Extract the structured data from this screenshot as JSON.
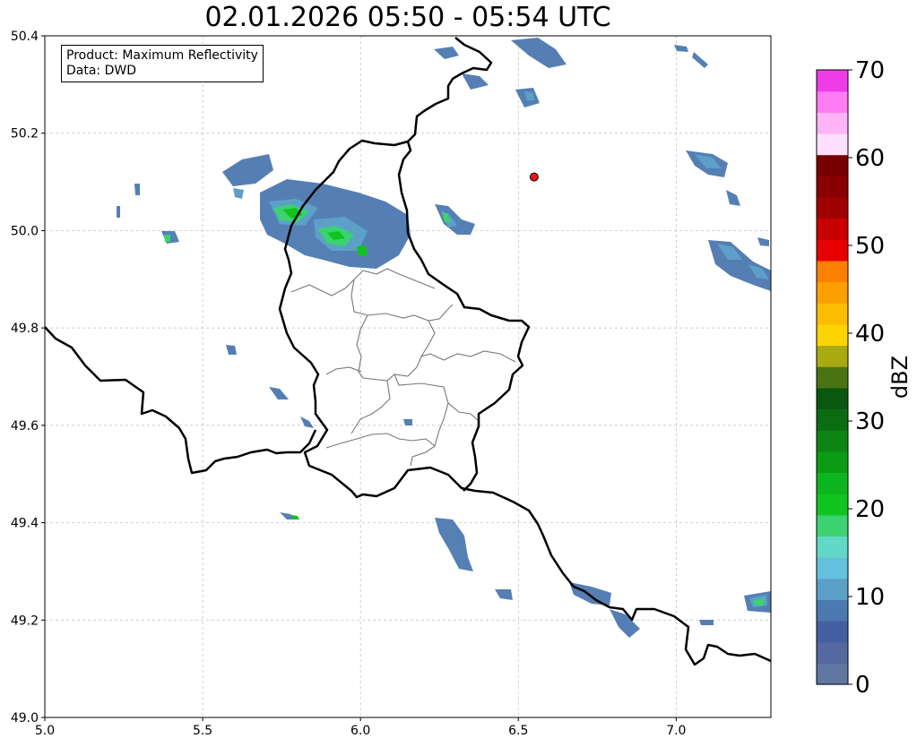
{
  "title": "02.01.2026 05:50 - 05:54 UTC",
  "info_box": {
    "product": "Product: Maximum Reflectivity",
    "data_source": "Data: DWD"
  },
  "map": {
    "x_ticks": [
      "5.0",
      "5.5",
      "6.0",
      "6.5",
      "7.0"
    ],
    "y_ticks": [
      "50.4",
      "50.2",
      "50.0",
      "49.8",
      "49.6",
      "49.4",
      "49.2",
      "49.0"
    ],
    "lon_range": [
      5.0,
      7.3
    ],
    "lat_range": [
      49.0,
      50.4
    ],
    "grid": true,
    "marker": {
      "lon": 6.55,
      "lat": 50.11,
      "color": "#e8141e"
    }
  },
  "colorbar": {
    "unit": "dBZ",
    "range": [
      0,
      70
    ],
    "tick_labels": [
      "0",
      "10",
      "20",
      "30",
      "40",
      "50",
      "60",
      "70"
    ],
    "colors": [
      "#6176a3",
      "#5668a0",
      "#445fa0",
      "#4c79b0",
      "#5ca0c8",
      "#64c0dc",
      "#64d8c8",
      "#3cd270",
      "#10c41e",
      "#0cb41e",
      "#0c9c14",
      "#0e8414",
      "#0c6c12",
      "#0a5810",
      "#4a7414",
      "#a8aa10",
      "#fcd400",
      "#fcbc00",
      "#fca000",
      "#fc8000",
      "#e60000",
      "#c80000",
      "#a00000",
      "#8a0000",
      "#780000",
      "#ffe0fc",
      "#ffb4f8",
      "#ff7cf4",
      "#ee3ce8"
    ]
  }
}
